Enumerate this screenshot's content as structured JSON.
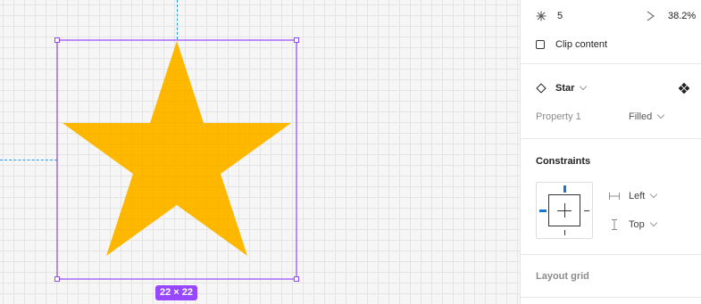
{
  "canvas": {
    "size_label": "22 × 22",
    "fill_color": "#ffb800",
    "selection_color": "#9747ff",
    "guide_color": "#2196f3"
  },
  "panel": {
    "star": {
      "points_icon": "sparkle-icon",
      "points_value": "5",
      "ratio_icon": "ratio-icon",
      "ratio_value": "38.2%"
    },
    "clip_content_label": "Clip content",
    "clip_content_checked": false,
    "component": {
      "name": "Star",
      "property_label": "Property 1",
      "property_value": "Filled"
    },
    "constraints": {
      "title": "Constraints",
      "horizontal": "Left",
      "vertical": "Top"
    },
    "layout_grid_label": "Layout grid"
  }
}
